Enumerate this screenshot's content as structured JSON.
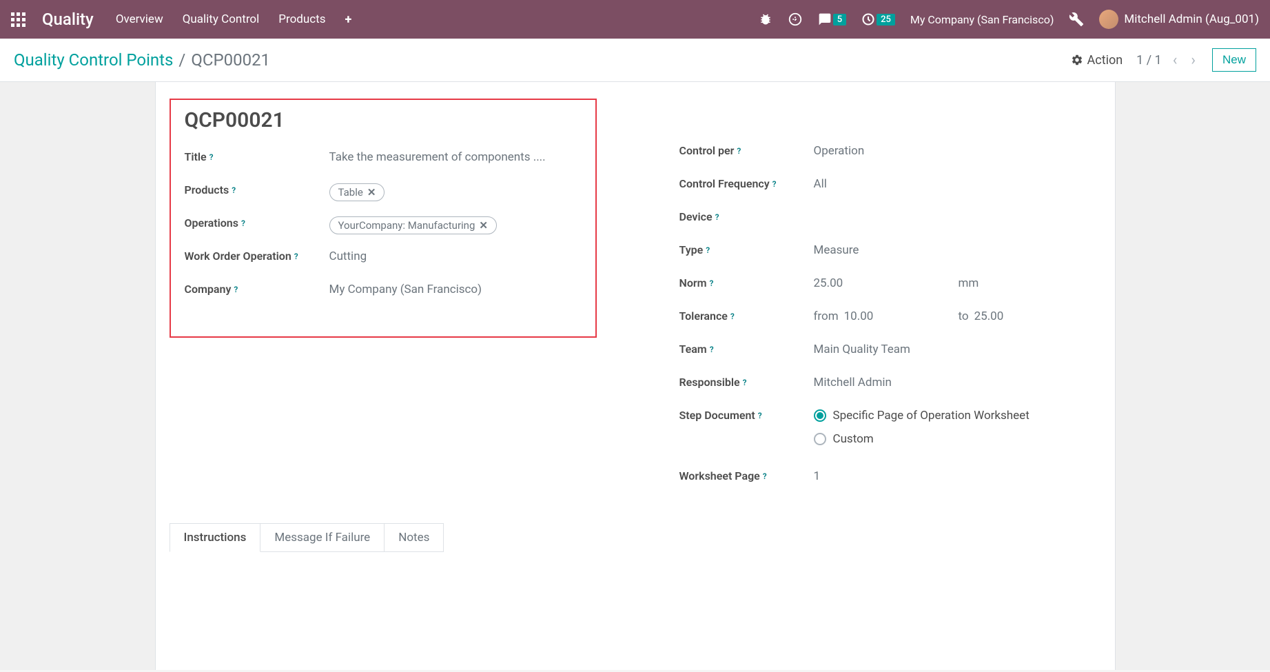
{
  "navbar": {
    "brand": "Quality",
    "menu": [
      "Overview",
      "Quality Control",
      "Products"
    ],
    "messages_badge": "5",
    "activities_badge": "25",
    "company": "My Company (San Francisco)",
    "user": "Mitchell Admin (Aug_001)"
  },
  "controlbar": {
    "breadcrumb_parent": "Quality Control Points",
    "breadcrumb_current": "QCP00021",
    "action_label": "Action",
    "pager": "1 / 1",
    "new_label": "New"
  },
  "record": {
    "name": "QCP00021",
    "fields_left": {
      "title_label": "Title",
      "title_value": "Take the measurement of components ....",
      "products_label": "Products",
      "products_tag": "Table",
      "operations_label": "Operations",
      "operations_tag": "YourCompany: Manufacturing",
      "work_order_op_label": "Work Order Operation",
      "work_order_op_value": "Cutting",
      "company_label": "Company",
      "company_value": "My Company (San Francisco)"
    },
    "fields_right": {
      "control_per_label": "Control per",
      "control_per_value": "Operation",
      "control_freq_label": "Control Frequency",
      "control_freq_value": "All",
      "device_label": "Device",
      "device_value": "",
      "type_label": "Type",
      "type_value": "Measure",
      "norm_label": "Norm",
      "norm_value": "25.00",
      "norm_unit": "mm",
      "tolerance_label": "Tolerance",
      "tolerance_from_label": "from",
      "tolerance_from_value": "10.00",
      "tolerance_to_label": "to",
      "tolerance_to_value": "25.00",
      "team_label": "Team",
      "team_value": "Main Quality Team",
      "responsible_label": "Responsible",
      "responsible_value": "Mitchell Admin",
      "step_doc_label": "Step Document",
      "step_doc_option1": "Specific Page of Operation Worksheet",
      "step_doc_option2": "Custom",
      "worksheet_page_label": "Worksheet Page",
      "worksheet_page_value": "1"
    }
  },
  "tabs": [
    "Instructions",
    "Message If Failure",
    "Notes"
  ]
}
